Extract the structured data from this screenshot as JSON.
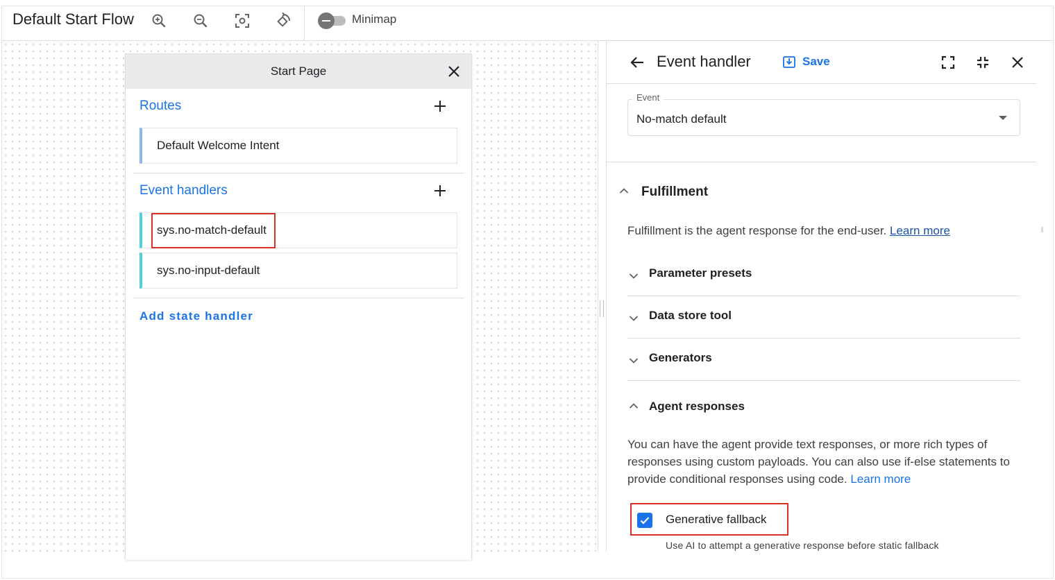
{
  "toolbar": {
    "title": "Default Start Flow",
    "minimap_label": "Minimap",
    "icons": [
      "zoom-in-icon",
      "zoom-out-icon",
      "fit-view-icon",
      "reset-rotate-icon"
    ]
  },
  "start_page": {
    "title": "Start Page",
    "routes_label": "Routes",
    "routes": [
      {
        "label": "Default Welcome Intent"
      }
    ],
    "event_handlers_label": "Event handlers",
    "event_handlers": [
      {
        "label": "sys.no-match-default"
      },
      {
        "label": "sys.no-input-default"
      }
    ],
    "add_state_handler_label": "Add state handler"
  },
  "panel": {
    "title": "Event handler",
    "save_label": "Save",
    "event_label": "Event",
    "event_value": "No-match default",
    "fulfillment_title": "Fulfillment",
    "fulfillment_desc": "Fulfillment is the agent response for the end-user.",
    "learn_more": "Learn more",
    "sections": [
      {
        "label": "Parameter presets"
      },
      {
        "label": "Data store tool"
      },
      {
        "label": "Generators"
      }
    ],
    "agent_responses_title": "Agent responses",
    "agent_responses_desc": "You can have the agent provide text responses, or more rich types of responses using custom payloads. You can also use if-else statements to provide conditional responses using code.",
    "agent_learn_more": "Learn more",
    "generative_fallback_label": "Generative fallback",
    "generative_fallback_checked": true,
    "generative_fallback_help": "Use AI to attempt a generative response before static fallback"
  },
  "colors": {
    "accent": "#1a73e8",
    "highlight": "#d93025",
    "route_bar": "#8ab4f8",
    "event_bar": "#4dd0e1"
  }
}
